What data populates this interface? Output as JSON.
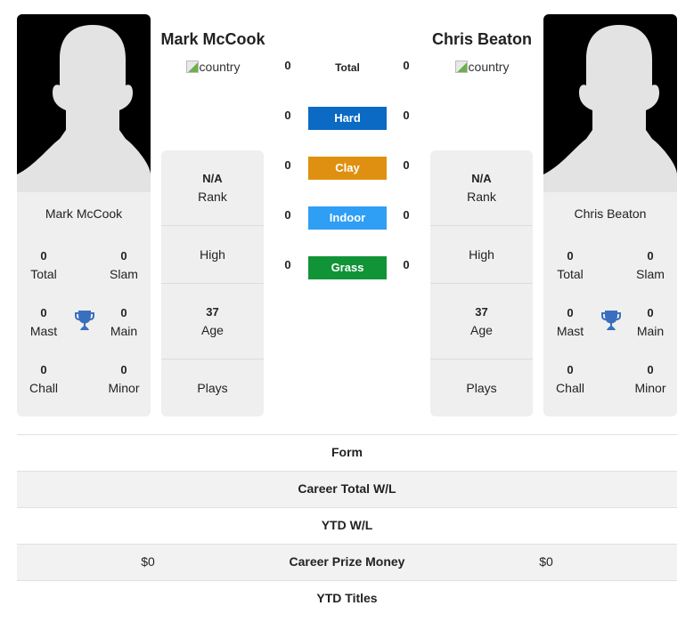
{
  "players": [
    {
      "name": "Mark McCook",
      "country_alt": "country",
      "card_name": "Mark McCook",
      "titles": {
        "total": {
          "value": "0",
          "label": "Total"
        },
        "slam": {
          "value": "0",
          "label": "Slam"
        },
        "mast": {
          "value": "0",
          "label": "Mast"
        },
        "main": {
          "value": "0",
          "label": "Main"
        },
        "chall": {
          "value": "0",
          "label": "Chall"
        },
        "minor": {
          "value": "0",
          "label": "Minor"
        }
      },
      "info": {
        "rank": {
          "value": "N/A",
          "label": "Rank"
        },
        "high": {
          "label": "High"
        },
        "age": {
          "value": "37",
          "label": "Age"
        },
        "plays": {
          "label": "Plays"
        }
      }
    },
    {
      "name": "Chris Beaton",
      "country_alt": "country",
      "card_name": "Chris Beaton",
      "titles": {
        "total": {
          "value": "0",
          "label": "Total"
        },
        "slam": {
          "value": "0",
          "label": "Slam"
        },
        "mast": {
          "value": "0",
          "label": "Mast"
        },
        "main": {
          "value": "0",
          "label": "Main"
        },
        "chall": {
          "value": "0",
          "label": "Chall"
        },
        "minor": {
          "value": "0",
          "label": "Minor"
        }
      },
      "info": {
        "rank": {
          "value": "N/A",
          "label": "Rank"
        },
        "high": {
          "label": "High"
        },
        "age": {
          "value": "37",
          "label": "Age"
        },
        "plays": {
          "label": "Plays"
        }
      }
    }
  ],
  "surfaces": [
    {
      "label": "Total",
      "left": "0",
      "right": "0",
      "color": ""
    },
    {
      "label": "Hard",
      "left": "0",
      "right": "0",
      "color": "#0a6ac4"
    },
    {
      "label": "Clay",
      "left": "0",
      "right": "0",
      "color": "#e09010"
    },
    {
      "label": "Indoor",
      "left": "0",
      "right": "0",
      "color": "#2f9ef5"
    },
    {
      "label": "Grass",
      "left": "0",
      "right": "0",
      "color": "#119437"
    }
  ],
  "comparison": [
    {
      "label": "Form",
      "left": "",
      "right": ""
    },
    {
      "label": "Career Total W/L",
      "left": "",
      "right": ""
    },
    {
      "label": "YTD W/L",
      "left": "",
      "right": ""
    },
    {
      "label": "Career Prize Money",
      "left": "$0",
      "right": "$0"
    },
    {
      "label": "YTD Titles",
      "left": "",
      "right": ""
    }
  ],
  "icons": {
    "trophy": "trophy-icon",
    "avatar": "silhouette-avatar",
    "flag": "broken-image-icon"
  },
  "colors": {
    "trophy": "#3a6fc0",
    "card_bg": "#efefef",
    "alt_row": "#f2f2f2"
  }
}
